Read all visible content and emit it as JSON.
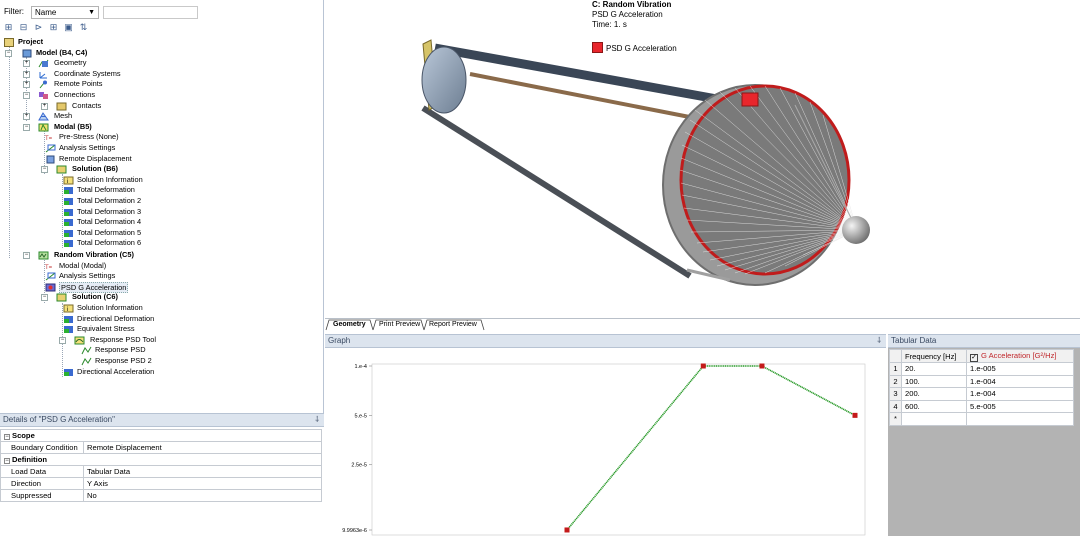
{
  "filter": {
    "label": "Filter:",
    "value": "Name",
    "search_value": ""
  },
  "tree": {
    "project": "Project",
    "model": "Model (B4, C4)",
    "geometry": "Geometry",
    "coordinate_systems": "Coordinate Systems",
    "remote_points": "Remote Points",
    "connections": "Connections",
    "contacts": "Contacts",
    "mesh": "Mesh",
    "modal": "Modal (B5)",
    "pre_stress": "Pre-Stress (None)",
    "analysis_settings_b": "Analysis Settings",
    "remote_displacement": "Remote Displacement",
    "solution_b6": "Solution (B6)",
    "solution_information_b": "Solution Information",
    "total_deformation": "Total Deformation",
    "total_deformation_2": "Total Deformation 2",
    "total_deformation_3": "Total Deformation 3",
    "total_deformation_4": "Total Deformation 4",
    "total_deformation_5": "Total Deformation 5",
    "total_deformation_6": "Total Deformation 6",
    "random_vibration": "Random Vibration (C5)",
    "modal_modal": "Modal (Modal)",
    "analysis_settings_c": "Analysis Settings",
    "psd_g_acceleration": "PSD G Acceleration",
    "solution_c6": "Solution (C6)",
    "solution_information_c": "Solution Information",
    "directional_deformation": "Directional Deformation",
    "equivalent_stress": "Equivalent Stress",
    "response_psd_tool": "Response PSD Tool",
    "response_psd": "Response PSD",
    "response_psd_2": "Response PSD 2",
    "directional_acceleration": "Directional Acceleration"
  },
  "details": {
    "title": "Details of \"PSD G Acceleration\"",
    "pin": "⸸",
    "group_scope": "Scope",
    "boundary_condition_label": "Boundary Condition",
    "boundary_condition_value": "Remote Displacement",
    "group_definition": "Definition",
    "load_data_label": "Load Data",
    "load_data_value": "Tabular Data",
    "direction_label": "Direction",
    "direction_value": "Y Axis",
    "suppressed_label": "Suppressed",
    "suppressed_value": "No"
  },
  "viewport": {
    "title": "C: Random Vibration",
    "subtitle": "PSD G Acceleration",
    "time": "Time: 1. s",
    "legend_label": "PSD G Acceleration",
    "legend_color": "#e8262c"
  },
  "tabs": {
    "geometry": "Geometry",
    "print_preview": "Print Preview",
    "report_preview": "Report Preview"
  },
  "graph": {
    "title": "Graph",
    "pin": "⸸"
  },
  "chart_data": {
    "type": "line",
    "x": [
      20,
      100,
      200,
      600
    ],
    "values": [
      1e-05,
      0.0001,
      0.0001,
      5e-05
    ],
    "ytick_labels": [
      "1.e-4",
      "5.e-5",
      "2.5e-5",
      "9.9963e-6"
    ],
    "ytick_values": [
      0.0001,
      5e-05,
      2.5e-05,
      9.9963e-06
    ],
    "xscale": "log",
    "yscale": "log",
    "line_color": "#2a9a2a",
    "marker_color": "#c41a1a"
  },
  "tabular": {
    "title": "Tabular Data",
    "col1": "Frequency [Hz]",
    "col2": "G Acceleration [G²/Hz]",
    "rows": [
      {
        "n": "1",
        "f": "20.",
        "g": "1.e-005"
      },
      {
        "n": "2",
        "f": "100.",
        "g": "1.e-004"
      },
      {
        "n": "3",
        "f": "200.",
        "g": "1.e-004"
      },
      {
        "n": "4",
        "f": "600.",
        "g": "5.e-005"
      }
    ],
    "new_row": "*"
  }
}
